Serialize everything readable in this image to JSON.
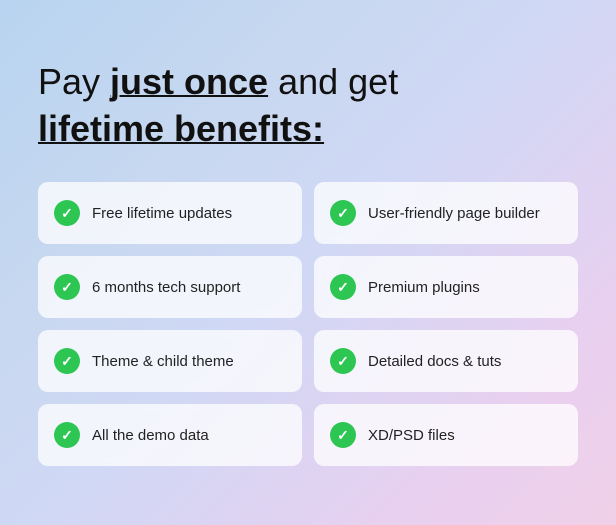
{
  "headline": {
    "part1": "Pay ",
    "just_once": "just once",
    "part2": " and get",
    "lifetime_benefits": "lifetime benefits:"
  },
  "benefits": [
    {
      "id": "free-lifetime-updates",
      "label": "Free lifetime updates"
    },
    {
      "id": "user-friendly-page-builder",
      "label": "User-friendly page builder"
    },
    {
      "id": "6-months-tech-support",
      "label": "6 months tech support"
    },
    {
      "id": "premium-plugins",
      "label": "Premium plugins"
    },
    {
      "id": "theme-child-theme",
      "label": "Theme & child theme"
    },
    {
      "id": "detailed-docs-tuts",
      "label": "Detailed docs & tuts"
    },
    {
      "id": "all-demo-data",
      "label": "All the demo data"
    },
    {
      "id": "xd-psd-files",
      "label": "XD/PSD files"
    }
  ]
}
